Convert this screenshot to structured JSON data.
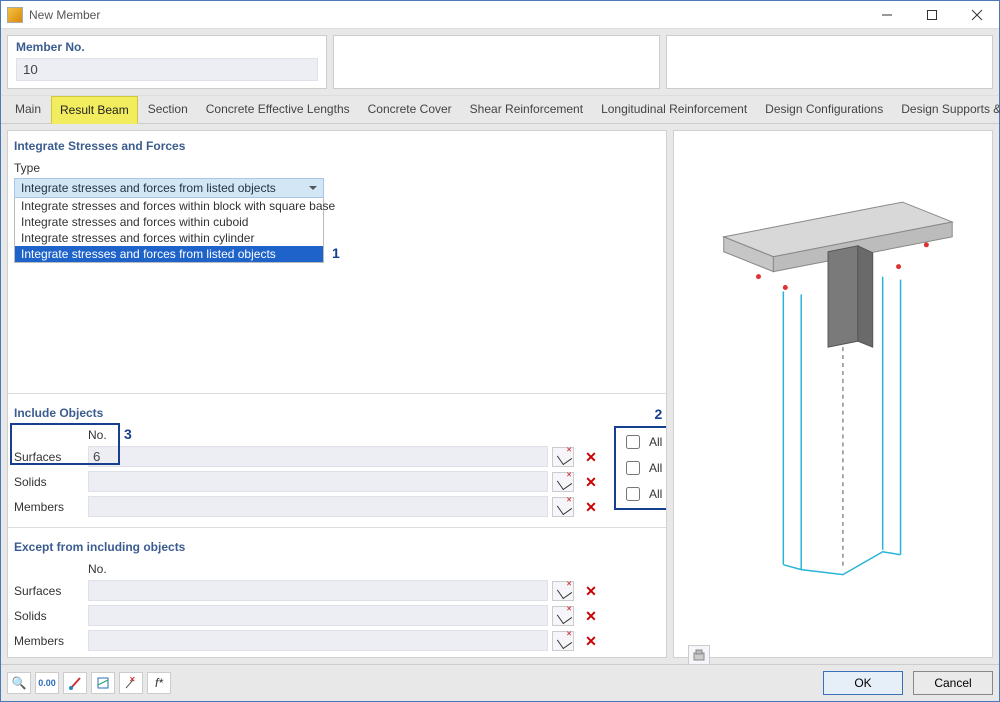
{
  "window": {
    "title": "New Member"
  },
  "header": {
    "member_no_label": "Member No.",
    "member_no_value": "10"
  },
  "tabs": [
    "Main",
    "Result Beam",
    "Section",
    "Concrete Effective Lengths",
    "Concrete Cover",
    "Shear Reinforcement",
    "Longitudinal Reinforcement",
    "Design Configurations",
    "Design Supports & Deflection"
  ],
  "active_tab": 1,
  "integrate": {
    "title": "Integrate Stresses and Forces",
    "type_label": "Type",
    "selected": "Integrate stresses and forces from listed objects",
    "options": [
      "Integrate stresses and forces within block with square base",
      "Integrate stresses and forces within cuboid",
      "Integrate stresses and forces within cylinder",
      "Integrate stresses and forces from listed objects"
    ],
    "annot1": "1"
  },
  "include": {
    "title": "Include Objects",
    "no_header": "No.",
    "annot2": "2",
    "annot3": "3",
    "rows": [
      {
        "label": "Surfaces",
        "value": "6",
        "all": "All"
      },
      {
        "label": "Solids",
        "value": "",
        "all": "All"
      },
      {
        "label": "Members",
        "value": "",
        "all": "All"
      }
    ]
  },
  "except": {
    "title": "Except from including objects",
    "no_header": "No.",
    "rows": [
      {
        "label": "Surfaces",
        "value": ""
      },
      {
        "label": "Solids",
        "value": ""
      },
      {
        "label": "Members",
        "value": ""
      }
    ]
  },
  "buttons": {
    "ok": "OK",
    "cancel": "Cancel"
  }
}
